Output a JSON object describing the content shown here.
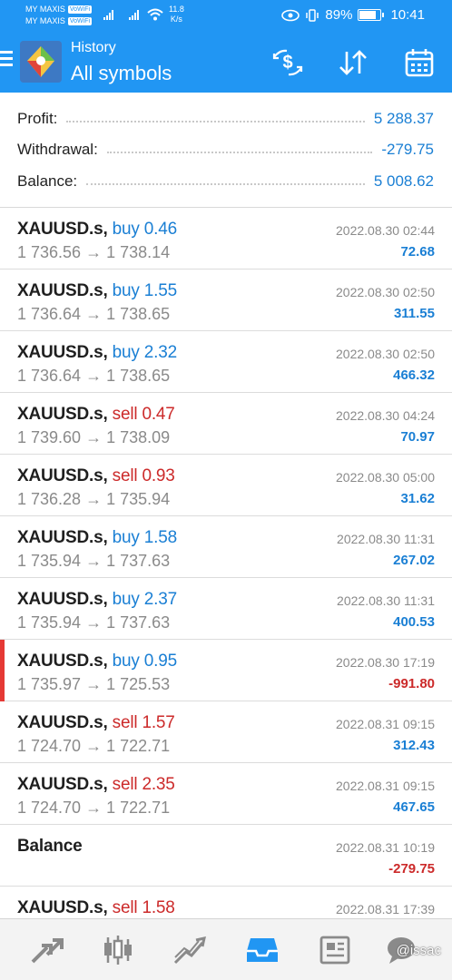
{
  "status_bar": {
    "carrier1": "MY MAXIS",
    "carrier2": "MY MAXIS",
    "wifi_tag": "VoWiFi",
    "speed_value": "11.8",
    "speed_unit": "K/s",
    "battery": "89%",
    "time": "10:41"
  },
  "app_bar": {
    "title": "History",
    "subtitle": "All symbols",
    "accent": "#2196f3"
  },
  "summary": {
    "profit_label": "Profit:",
    "profit_value": "5 288.37",
    "withdrawal_label": "Withdrawal:",
    "withdrawal_value": "-279.75",
    "balance_label": "Balance:",
    "balance_value": "5 008.62"
  },
  "deals": [
    {
      "symbol": "XAUUSD.s,",
      "direction": "buy",
      "volume": "0.46",
      "prices": "1 736.56 → 1 738.14",
      "time": "2022.08.30 02:44",
      "profit": "72.68"
    },
    {
      "symbol": "XAUUSD.s,",
      "direction": "buy",
      "volume": "1.55",
      "prices": "1 736.64 → 1 738.65",
      "time": "2022.08.30 02:50",
      "profit": "311.55"
    },
    {
      "symbol": "XAUUSD.s,",
      "direction": "buy",
      "volume": "2.32",
      "prices": "1 736.64 → 1 738.65",
      "time": "2022.08.30 02:50",
      "profit": "466.32"
    },
    {
      "symbol": "XAUUSD.s,",
      "direction": "sell",
      "volume": "0.47",
      "prices": "1 739.60 → 1 738.09",
      "time": "2022.08.30 04:24",
      "profit": "70.97"
    },
    {
      "symbol": "XAUUSD.s,",
      "direction": "sell",
      "volume": "0.93",
      "prices": "1 736.28 → 1 735.94",
      "time": "2022.08.30 05:00",
      "profit": "31.62"
    },
    {
      "symbol": "XAUUSD.s,",
      "direction": "buy",
      "volume": "1.58",
      "prices": "1 735.94 → 1 737.63",
      "time": "2022.08.30 11:31",
      "profit": "267.02"
    },
    {
      "symbol": "XAUUSD.s,",
      "direction": "buy",
      "volume": "2.37",
      "prices": "1 735.94 → 1 737.63",
      "time": "2022.08.30 11:31",
      "profit": "400.53"
    },
    {
      "symbol": "XAUUSD.s,",
      "direction": "buy",
      "volume": "0.95",
      "prices": "1 735.97 → 1 725.53",
      "time": "2022.08.30 17:19",
      "profit": "-991.80"
    },
    {
      "symbol": "XAUUSD.s,",
      "direction": "sell",
      "volume": "1.57",
      "prices": "1 724.70 → 1 722.71",
      "time": "2022.08.31 09:15",
      "profit": "312.43"
    },
    {
      "symbol": "XAUUSD.s,",
      "direction": "sell",
      "volume": "2.35",
      "prices": "1 724.70 → 1 722.71",
      "time": "2022.08.31 09:15",
      "profit": "467.65"
    }
  ],
  "balance_entry": {
    "label": "Balance",
    "time": "2022.08.31 10:19",
    "profit": "-279.75"
  },
  "partial_deal": {
    "symbol": "XAUUSD.s,",
    "direction": "sell",
    "volume": "1.58",
    "time": "2022.08.31 17:39"
  },
  "bottom_nav": {
    "items": [
      "quotes-icon",
      "chart-icon",
      "trade-icon",
      "history-icon",
      "news-icon",
      "messages-icon"
    ],
    "watermark": "@issac"
  },
  "colors": {
    "positive": "#1a7fd4",
    "negative": "#cc2a2a",
    "muted": "#8a8a8a"
  }
}
